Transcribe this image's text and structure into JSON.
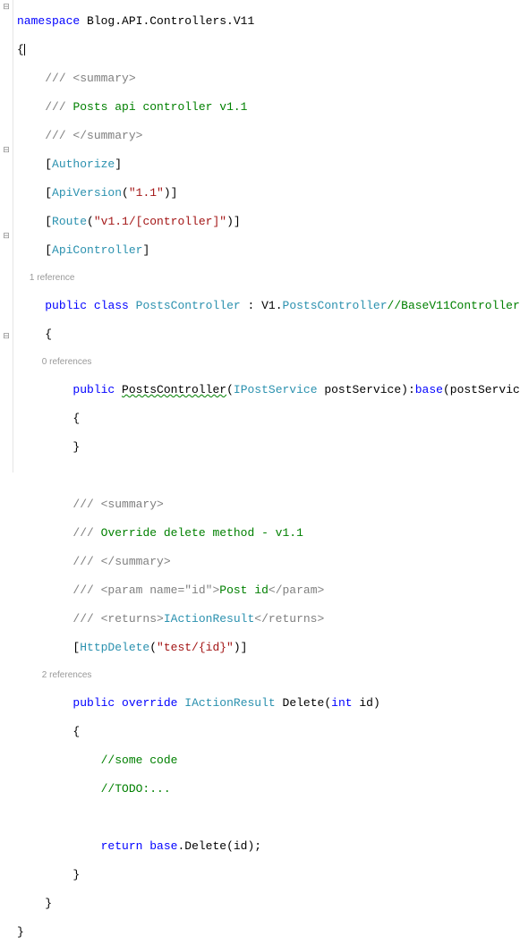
{
  "gutter": {
    "collapse": "⊟"
  },
  "ns": {
    "kw": "namespace",
    "name": "Blog.API.Controllers.V11"
  },
  "xml": {
    "sum_open": "/// <summary>",
    "sum_close": "/// </summary>"
  },
  "cls": {
    "doc": "Posts api controller v1.1",
    "attr_authorize": "Authorize",
    "attr_apiversion": "ApiVersion",
    "apiversion_val": "\"1.1\"",
    "attr_route": "Route",
    "route_val": "\"v1.1/[controller]\"",
    "attr_apicontroller": "ApiController",
    "refs": "1 reference",
    "public": "public",
    "class_kw": "class",
    "name": "PostsController",
    "colon": " : ",
    "base_ns": "V1.",
    "base_name": "PostsController",
    "base_comment": "//BaseV11Controller"
  },
  "ctor": {
    "refs": "0 references",
    "public": "public",
    "name": "PostsController",
    "param_type": "IPostService",
    "param_name": " postService",
    "base_kw": "base",
    "base_arg": "postService"
  },
  "del": {
    "doc": "Override delete method - v1.1",
    "param_open": "/// <param name=",
    "param_name_val": "\"id\"",
    "param_mid": ">",
    "param_text": "Post id",
    "param_close": "</param>",
    "ret_open": "/// <returns>",
    "ret_type": "IActionResult",
    "ret_close": "</returns>",
    "attr_httpdelete": "HttpDelete",
    "httpdelete_val": "\"test/{id}\"",
    "refs": "2 references",
    "public": "public",
    "override": "override",
    "ret_t": "IActionResult",
    "name": "Delete",
    "p_type": "int",
    "p_name": " id",
    "body_c1": "//some code",
    "body_c2": "//TODO:...",
    "return_kw": "return",
    "base_kw": "base",
    "call": ".Delete(id);"
  }
}
